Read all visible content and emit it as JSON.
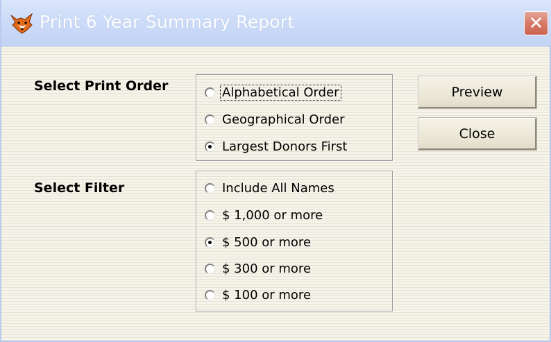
{
  "window": {
    "title": "Print 6 Year Summary Report",
    "app_icon": "fox-icon",
    "close_glyph": "✕"
  },
  "print_order": {
    "label": "Select Print Order",
    "options": [
      {
        "label": "Alphabetical Order",
        "checked": false,
        "focused": true
      },
      {
        "label": "Geographical Order",
        "checked": false,
        "focused": false
      },
      {
        "label": "Largest Donors First",
        "checked": true,
        "focused": false
      }
    ]
  },
  "filter": {
    "label": "Select Filter",
    "options": [
      {
        "label": "Include All Names",
        "checked": false
      },
      {
        "label": "$ 1,000 or more",
        "checked": false
      },
      {
        "label": "$ 500 or more",
        "checked": true
      },
      {
        "label": "$ 300 or more",
        "checked": false
      },
      {
        "label": "$ 100 or more",
        "checked": false
      }
    ]
  },
  "buttons": {
    "preview": "Preview",
    "close": "Close"
  },
  "colors": {
    "titlebar": "#c9d8f6",
    "close_button": "#d77a66",
    "dialog_bg": "#f3f1e4"
  }
}
